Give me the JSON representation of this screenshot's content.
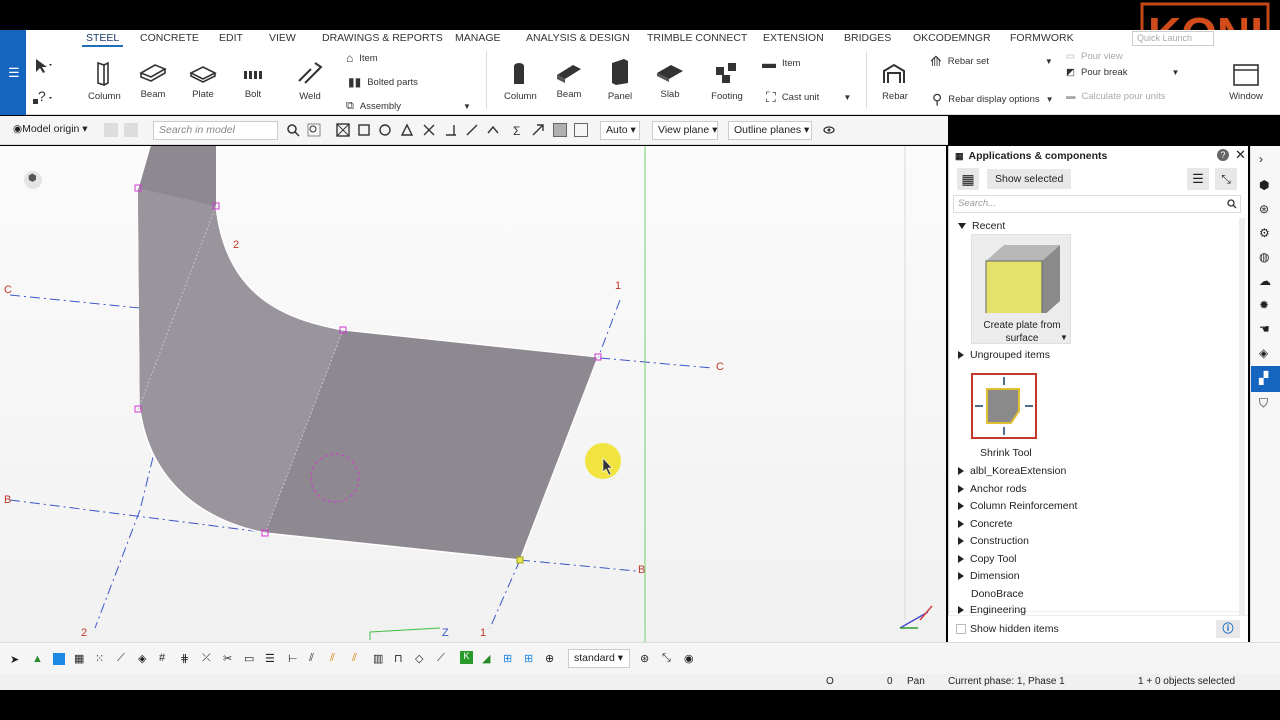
{
  "logo": {
    "text": "KONIA"
  },
  "quick_launch": {
    "placeholder": "Quick Launch"
  },
  "ribbon_tabs": [
    "STEEL",
    "CONCRETE",
    "EDIT",
    "VIEW",
    "DRAWINGS & REPORTS",
    "MANAGE",
    "ANALYSIS & DESIGN",
    "TRIMBLE CONNECT",
    "EXTENSION",
    "BRIDGES",
    "OKCODEMNGR",
    "FORMWORK"
  ],
  "ribbon": {
    "steel": {
      "column": "Column",
      "beam": "Beam",
      "plate": "Plate",
      "bolt": "Bolt",
      "weld": "Weld",
      "item": "Item",
      "bolted_parts": "Bolted parts",
      "assembly": "Assembly"
    },
    "concrete": {
      "column": "Column",
      "beam": "Beam",
      "panel": "Panel",
      "slab": "Slab",
      "footing": "Footing",
      "item": "Item",
      "cast_unit": "Cast unit"
    },
    "rebar": {
      "rebar": "Rebar",
      "rebar_set": "Rebar set",
      "rebar_display": "Rebar display options"
    },
    "pour": {
      "pour_view": "Pour view",
      "pour_break": "Pour break",
      "calc_pour": "Calculate pour units"
    },
    "window": "Window"
  },
  "toolbar2": {
    "model_origin": "Model origin",
    "search_placeholder": "Search in model",
    "auto": "Auto",
    "view_plane": "View plane",
    "outline_planes": "Outline planes"
  },
  "viewport": {
    "grid_labels": {
      "c_left": "C",
      "c_right": "C",
      "b_left": "B",
      "b_right": "B",
      "one_top": "1",
      "one_bottom": "1",
      "two_top": "2",
      "two_bottom": "2",
      "z_axis": "Z"
    }
  },
  "panel": {
    "title": "Applications & components",
    "show_selected": "Show selected",
    "search_placeholder": "Search...",
    "recent": "Recent",
    "create_plate_line1": "Create plate from",
    "create_plate_line2": "surface",
    "ungrouped": "Ungrouped items",
    "shrink_tool": "Shrink Tool",
    "groups": [
      "albl_KoreaExtension",
      "Anchor rods",
      "Column Reinforcement",
      "Concrete",
      "Construction",
      "Copy Tool",
      "Dimension",
      "DonoBrace",
      "Engineering"
    ],
    "show_hidden": "Show hidden items"
  },
  "bottombar": {
    "standard": "standard"
  },
  "status": {
    "o": "O",
    "zero": "0",
    "pan": "Pan",
    "phase": "Current phase: 1, Phase 1",
    "selected": "1 + 0 objects selected"
  },
  "colors": {
    "accent": "#1565c0",
    "plate": "#8e8890",
    "grid": "#c0392b",
    "logo": "#e8541f"
  }
}
